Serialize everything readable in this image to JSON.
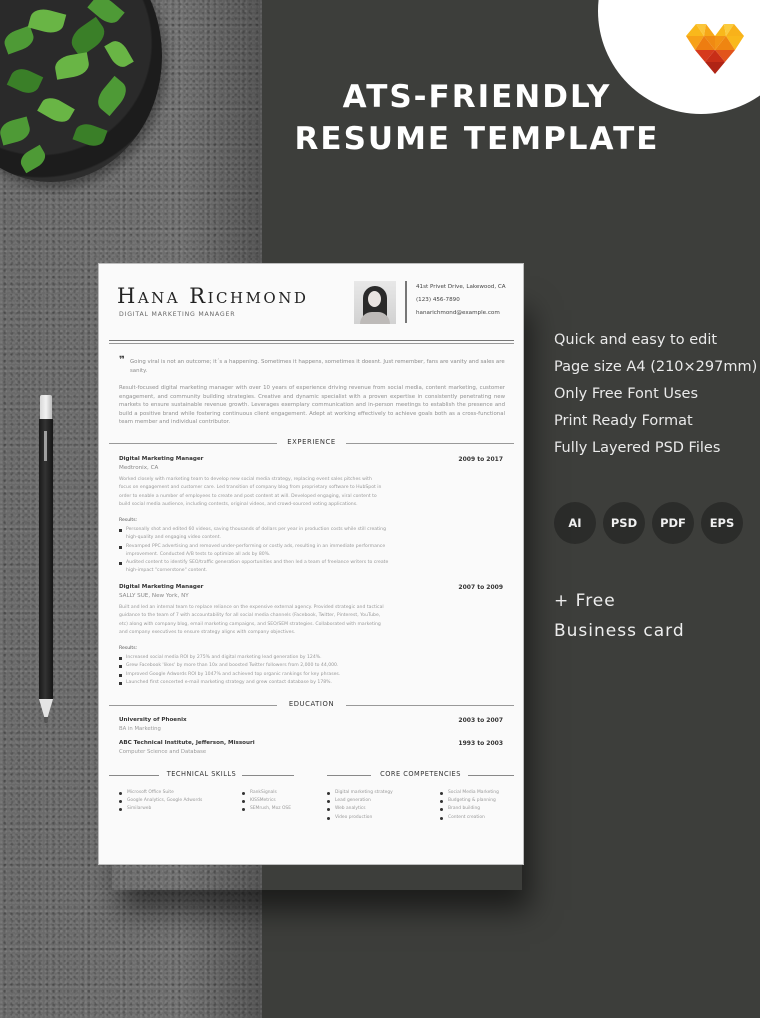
{
  "headline": {
    "line1": "ATS-FRIENDLY",
    "line2": "RESUME TEMPLATE"
  },
  "features": [
    "Quick and easy to edit",
    "Page size A4 (210×297mm)",
    "Only Free Font Uses",
    "Print Ready Format",
    "Fully Layered PSD Files"
  ],
  "formats": [
    "AI",
    "PSD",
    "PDF",
    "EPS"
  ],
  "bonus": {
    "line1": "+ Free",
    "line2": "Business card"
  },
  "brand": {
    "logo_icon": "polygon-heart-icon",
    "colors": {
      "yellow": "#f9b81b",
      "orange": "#f08a12",
      "red": "#d63a1c",
      "dark_red": "#b02415"
    }
  },
  "resume": {
    "name": "Hana Richmond",
    "title": "DIGITAL MARKETING MANAGER",
    "contact": {
      "address": "41st Privet Drive, Lakewood, CA",
      "phone": "(123) 456-7890",
      "email": "hanarichmond@example.com"
    },
    "quote": "Going viral is not an outcome; it´s a happening. Sometimes it happens, sometimes it doesnt. Just remember, fans are vanity and sales are sanity.",
    "summary": "Result-focused digital marketing manager with over 10 years of experience driving revenue from social media, content marketing, customer engagement, and community building strategies. Creative and dynamic specialist with a proven expertise in consistently penetrating new markets to ensure sustainable revenue growth. Leverages exemplary communication and in-person meetings to establish the presence and build a positive brand while fostering continuous client engagement. Adept at working effectively to achieve goals both as a cross-functional team member and individual contributor.",
    "sections": {
      "experience": "EXPERIENCE",
      "education": "EDUCATION",
      "technical_skills": "TECHNICAL SKILLS",
      "core_competencies": "CORE COMPETENCIES"
    },
    "experience": [
      {
        "title": "Digital Marketing Manager",
        "company": "Medtronix, CA",
        "dates": "2009 to 2017",
        "description": "Worked closely with marketing team to develop new social media strategy, replacing event sales pitches with focus on engagement and customer care. Led transition of company blog from proprietary software to HubSpot in order to enable a number of employees to create and post content at will. Developed engaging, viral content to build social media audience, including contests, original videos, and crowd-sourced voting applications.",
        "results_label": "Results:",
        "results": [
          "Personally shot and edited 60 videos, saving thousands of dollars per year in production costs while still creating high-quality and engaging video content.",
          "Revamped PPC advertising and removed under-performing or costly ads, resulting in an immediate performance improvement. Conducted A/B tests to optimize all ads by 80%.",
          "Audited content to identify SEO/traffic generation opportunities and then led a team of freelance writers to create high-impact \"cornerstone\" content."
        ]
      },
      {
        "title": "Digital Marketing Manager",
        "company": "SALLY SUE, New York, NY",
        "dates": "2007 to 2009",
        "description": "Built and led an internal team to replace reliance on the expensive external agency. Provided strategic and tactical guidance to the team of 7 with accountability for all social media channels (Facebook, Twitter, Pinterest, YouTube, etc) along with company blog, email marketing campaigns, and SEO/SEM strategies. Collaborated with marketing and company executives to ensure strategy aligns with company objectives.",
        "results_label": "Results:",
        "results": [
          "Increased social media ROI by 275% and digital marketing lead generation by 124%.",
          "Grew Facebook 'likes' by more than 10x and boosted Twitter followers from 2,000 to 44,000.",
          "Improved Google Adwords ROI by 1047% and achieved top organic rankings for key phrases.",
          "Launched first concerted e-mail marketing strategy and grew contact database by 178%."
        ]
      }
    ],
    "education": [
      {
        "school": "University of Phoenix",
        "degree": "BA in Marketing",
        "dates": "2003 to 2007"
      },
      {
        "school": "ABC Technical Institute, Jefferson, Missouri",
        "degree": "Computer Science and Database",
        "dates": "1993 to 2003"
      }
    ],
    "technical_skills": {
      "col1": [
        "Microsoft Office Suite",
        "Google Analytics, Google Adwords",
        "Similarweb"
      ],
      "col2": [
        "RankSignals",
        "KISSMetrics",
        "SEMrush, Moz OSE"
      ]
    },
    "core_competencies": {
      "col1": [
        "Digital marketing strategy",
        "Lead generation",
        "Web analytics",
        "Video production"
      ],
      "col2": [
        "Social Media Marketing",
        "Budgeting & planning",
        "Brand building",
        "Content creation"
      ]
    }
  }
}
